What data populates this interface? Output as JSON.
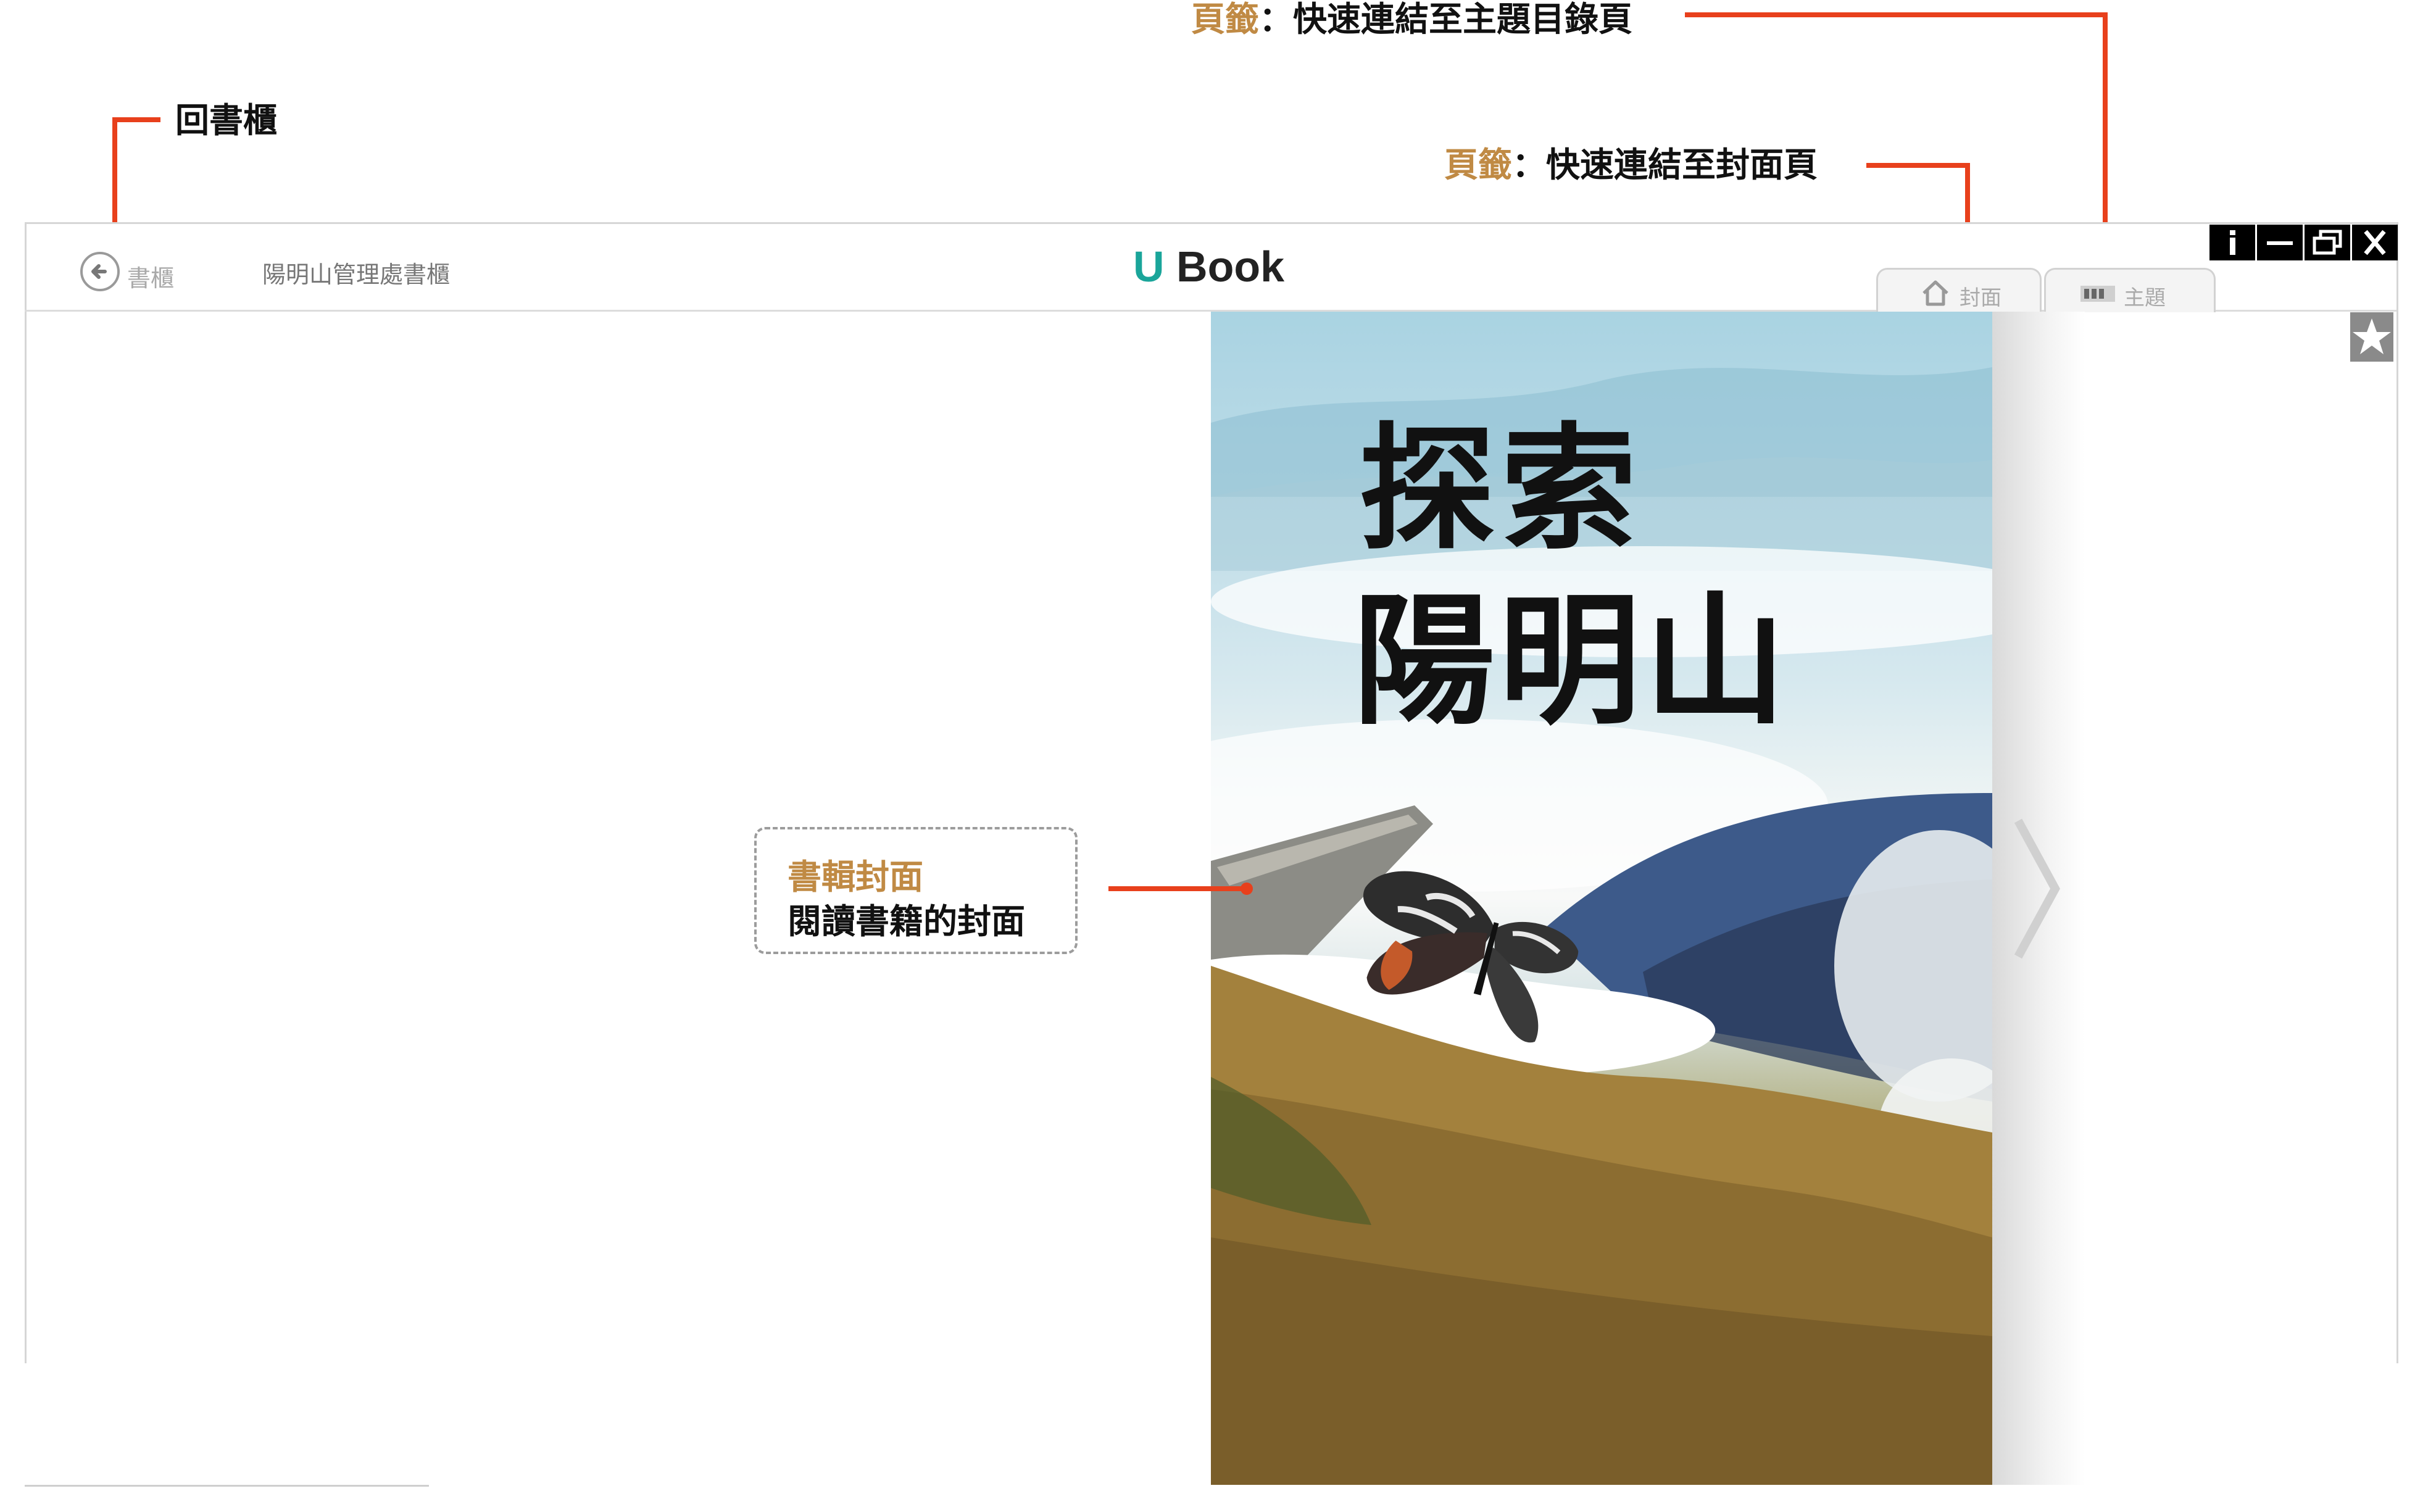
{
  "annotations": {
    "back_to_shelf": "回書櫃",
    "bookmark_topics_highlight": "頁籤",
    "bookmark_topics_text": "：快速連結至主題目錄頁",
    "bookmark_cover_highlight": "頁籤",
    "bookmark_cover_text": "：快速連結至封面頁",
    "cover_callout_title": "書輯封面",
    "cover_callout_text": "閱讀書籍的封面"
  },
  "toolbar": {
    "back_label": "書櫃",
    "shelf_title": "陽明山管理處書櫃",
    "brand_u": "U",
    "brand_text": "Book",
    "tab_cover": "封面",
    "tab_topics": "主題"
  },
  "book": {
    "cover_title_line1": "探索",
    "cover_title_line2": "陽明山"
  },
  "window_buttons": [
    "info-icon",
    "minimize-icon",
    "restore-icon",
    "close-icon"
  ],
  "colors": {
    "accent_red": "#e8401c",
    "highlight_gold": "#c08a44",
    "brand_teal": "#1aa59a"
  }
}
